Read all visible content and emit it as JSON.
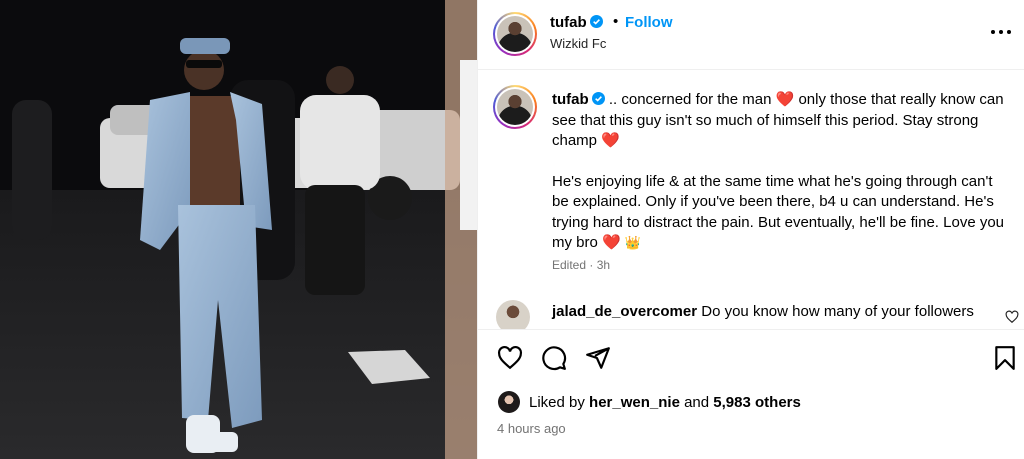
{
  "post": {
    "author": "tufab",
    "follow_label": "Follow",
    "separator": "•",
    "location": "Wizkid Fc",
    "icons": {
      "verified": "verified-badge-icon",
      "more": "more-options-icon",
      "like": "heart-icon",
      "comment": "comment-icon",
      "share": "share-icon",
      "save": "bookmark-icon"
    },
    "accent_color": "#0095f6"
  },
  "caption": {
    "author": "tufab",
    "line1_a": ".. concerned for the man",
    "emoji_heart": "❤️",
    "line1_b": "only those that really know can see that this guy isn't so much of himself this period. Stay strong champ",
    "para2": "He's enjoying life & at the same time what he's going through can't be explained. Only if you've been there, b4 u can understand. He's trying hard to distract the pain. But eventually, he'll be fine. Love you my bro",
    "emoji_crown": "👑",
    "edited": "Edited · 3h"
  },
  "comment": {
    "user": "jalad_de_overcomer",
    "text": "Do you know how many of your followers"
  },
  "likes": {
    "prefix": "Liked by",
    "user": "her_wen_nie",
    "and": "and",
    "count": "5,983 others"
  },
  "time_ago": "4 hours ago"
}
